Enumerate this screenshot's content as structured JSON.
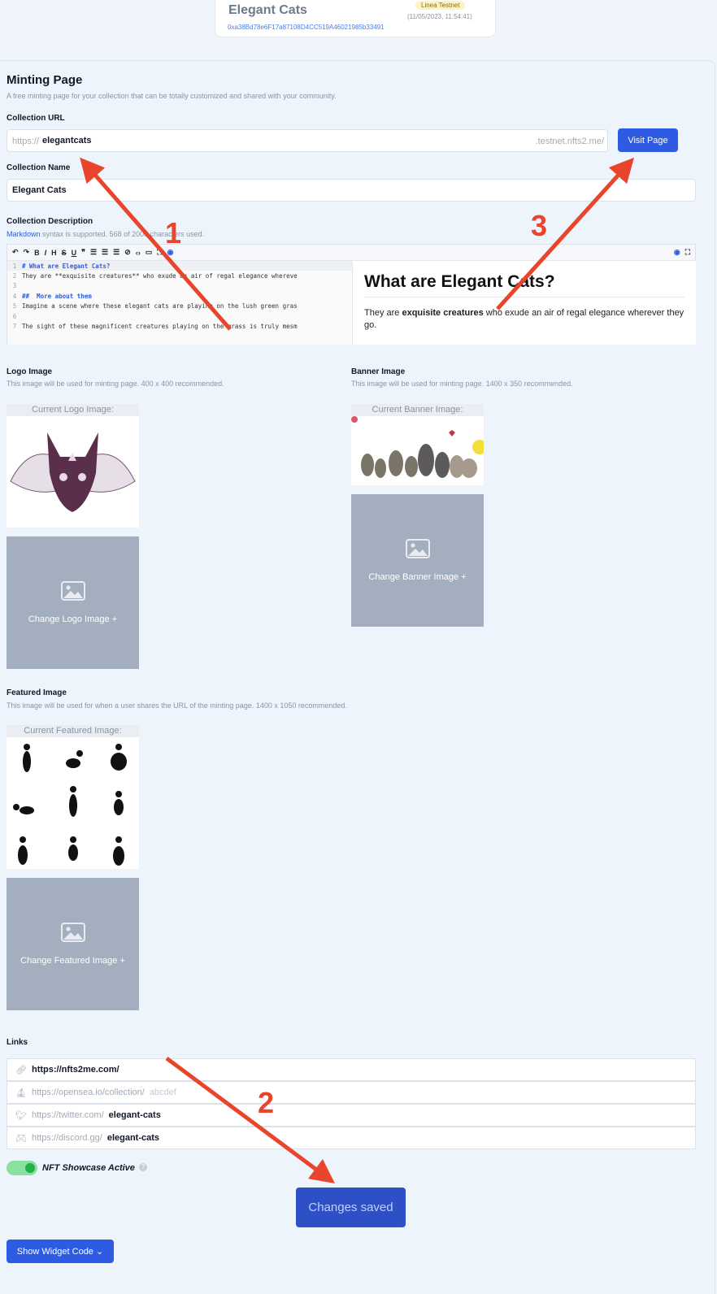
{
  "header": {
    "title": "Elegant Cats",
    "address": "0xa38Bd78e6F17a87108D4CC519A46021985b33491",
    "network_badge": "Linea Testnet",
    "date": "(11/05/2023, 11:54:41)"
  },
  "minting": {
    "title": "Minting Page",
    "subtitle": "A free minting page for your collection that can be totally customized and shared with your community.",
    "url_label": "Collection URL",
    "url_prefix": "https://",
    "url_value": "elegantcats",
    "url_suffix": ".testnet.nfts2.me/",
    "visit_button": "Visit Page",
    "name_label": "Collection Name",
    "name_value": "Elegant Cats",
    "desc_label": "Collection Description",
    "desc_hint_link": "Markdown",
    "desc_hint_rest": " syntax is supported. 568 of 2000 characters used.",
    "code_lines": [
      {
        "n": "1",
        "t": "# What are Elegant Cats?",
        "h": true
      },
      {
        "n": "2",
        "t": "They are **exquisite creatures** who exude an air of regal elegance whereve",
        "h": false
      },
      {
        "n": "3",
        "t": "",
        "h": false
      },
      {
        "n": "4",
        "t": "##  More about them",
        "h": true
      },
      {
        "n": "5",
        "t": "Imagine a scene where these elegant cats are playing on the lush green gras",
        "h": false
      },
      {
        "n": "6",
        "t": "",
        "h": false
      },
      {
        "n": "7",
        "t": "The sight of these magnificent creatures playing on the grass is truly mesm",
        "h": false
      }
    ],
    "preview_heading": "What are Elegant Cats?",
    "preview_text_1": "They are ",
    "preview_text_bold": "exquisite creatures",
    "preview_text_2": " who exude an air of regal elegance wherever they go."
  },
  "logo": {
    "label": "Logo Image",
    "hint": "This image will be used for minting page. 400 x 400 recommended.",
    "current": "Current Logo Image:",
    "change": "Change Logo Image"
  },
  "banner": {
    "label": "Banner Image",
    "hint": "This image will be used for minting page. 1400 x 350 recommended.",
    "current": "Current Banner Image:",
    "change": "Change Banner Image"
  },
  "featured": {
    "label": "Featured Image",
    "hint": "This image will be used for when a user shares the URL of the minting page. 1400 x 1050 recommended.",
    "current": "Current Featured Image:",
    "change": "Change Featured Image"
  },
  "links": {
    "label": "Links",
    "rows": [
      {
        "prefix": "",
        "value": "https://nfts2me.com/",
        "placeholder": "",
        "icon": "link-icon"
      },
      {
        "prefix": "https://opensea.io/collection/",
        "value": "",
        "placeholder": "abcdef",
        "icon": "opensea-icon"
      },
      {
        "prefix": "https://twitter.com/",
        "value": "elegant-cats",
        "placeholder": "",
        "icon": "twitter-icon"
      },
      {
        "prefix": "https://discord.gg/",
        "value": "elegant-cats",
        "placeholder": "",
        "icon": "discord-icon"
      }
    ]
  },
  "showcase": {
    "label": "NFT Showcase Active"
  },
  "save_button": "Changes saved",
  "widget_button": "Show Widget Code",
  "annotations": [
    "1",
    "2",
    "3"
  ],
  "colors": {
    "accent": "#2d5be3",
    "annotation": "#e8452c",
    "toggle": "#22b04a"
  }
}
